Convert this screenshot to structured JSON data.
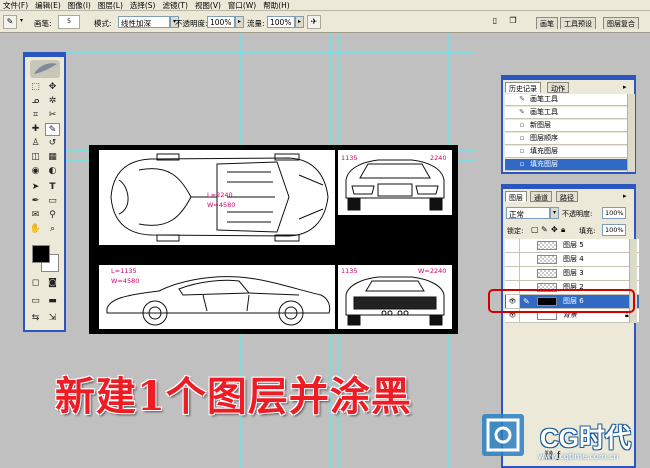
{
  "menu": [
    "文件(F)",
    "编辑(E)",
    "图像(I)",
    "图层(L)",
    "选择(S)",
    "滤镜(T)",
    "视图(V)",
    "窗口(W)",
    "帮助(H)"
  ],
  "options": {
    "brush_label": "画笔:",
    "brush_size": "5",
    "mode_label": "模式:",
    "mode_value": "线性加深",
    "opacity_label": "不透明度:",
    "opacity_value": "100%",
    "flow_label": "流量:",
    "flow_value": "100%",
    "well_tabs": [
      "画笔",
      "工具预设",
      "图层复合"
    ]
  },
  "blueprint": {
    "top_label_L": "L=2240",
    "top_label_W": "W=4580",
    "front_label_a": "1135",
    "front_label_b": "2240",
    "side_label_L": "L=1135",
    "side_label_W": "W=4580",
    "rear_label_a": "1135",
    "rear_label_b": "W=2240"
  },
  "history_panel": {
    "tabs": [
      "历史记录",
      "动作"
    ],
    "items": [
      {
        "label": "画笔工具",
        "icon": "brush-icon",
        "selected": false
      },
      {
        "label": "画笔工具",
        "icon": "brush-icon",
        "selected": false
      },
      {
        "label": "新图层",
        "icon": "new-layer-icon",
        "selected": false
      },
      {
        "label": "图层顺序",
        "icon": "layer-order-icon",
        "selected": false
      },
      {
        "label": "填充图层",
        "icon": "fill-icon",
        "selected": false
      },
      {
        "label": "填充图层",
        "icon": "fill-icon",
        "selected": true
      }
    ]
  },
  "layers_panel": {
    "tabs": [
      "图层",
      "通道",
      "路径"
    ],
    "blend_mode": "正常",
    "opacity_label": "不透明度:",
    "opacity_value": "100%",
    "lock_label": "锁定:",
    "fill_label": "填充:",
    "fill_value": "100%",
    "layers": [
      {
        "name": "图层 5",
        "selected": false,
        "visible": false
      },
      {
        "name": "图层 4",
        "selected": false,
        "visible": false
      },
      {
        "name": "图层 3",
        "selected": false,
        "visible": false
      },
      {
        "name": "图层 2",
        "selected": false,
        "visible": false
      },
      {
        "name": "图层 6",
        "selected": true,
        "visible": true,
        "black_thumb": true
      },
      {
        "name": "背景",
        "selected": false,
        "visible": true,
        "locked": true
      }
    ]
  },
  "caption": "新建1个图层并涂黑",
  "logo": {
    "name": "CG时代",
    "url": "www.cgtime.com.cn"
  },
  "colors": {
    "accent_blue": "#2b55c0",
    "highlight": "#316ac5",
    "caption_red": "#ee1c25",
    "guide_cyan": "#6fe3e6",
    "dimension_magenta": "#d0006a"
  }
}
